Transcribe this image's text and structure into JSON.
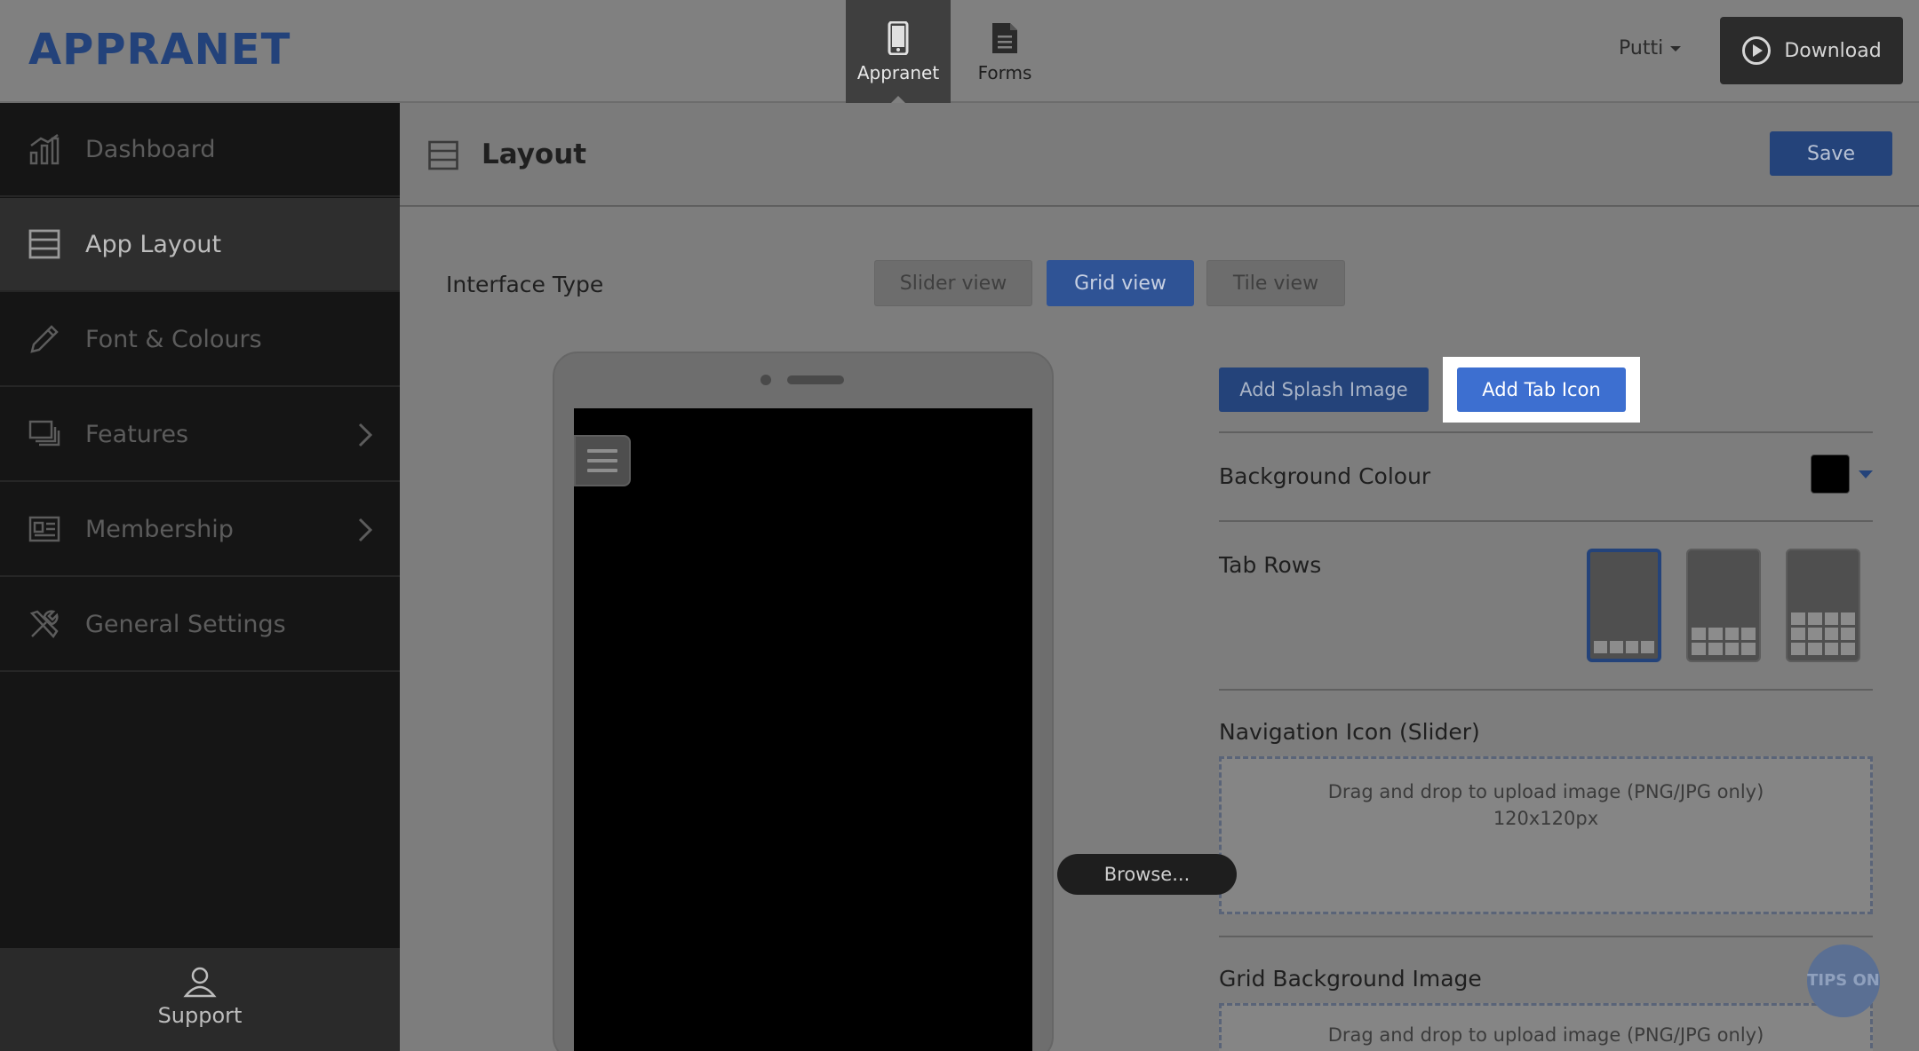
{
  "app": {
    "logo": "APPRANET",
    "nav_tabs": [
      {
        "label": "Appranet",
        "icon": "phone-icon",
        "active": true
      },
      {
        "label": "Forms",
        "icon": "document-icon",
        "active": false
      }
    ],
    "user_name": "Putti",
    "download_label": "Download"
  },
  "sidebar": {
    "items": [
      {
        "label": "Dashboard",
        "icon": "bar-chart-icon",
        "active": false,
        "has_children": false
      },
      {
        "label": "App Layout",
        "icon": "layout-icon",
        "active": true,
        "has_children": false
      },
      {
        "label": "Font & Colours",
        "icon": "pencil-icon",
        "active": false,
        "has_children": false
      },
      {
        "label": "Features",
        "icon": "monitor-stack-icon",
        "active": false,
        "has_children": true
      },
      {
        "label": "Membership",
        "icon": "id-card-icon",
        "active": false,
        "has_children": true
      },
      {
        "label": "General Settings",
        "icon": "tools-icon",
        "active": false,
        "has_children": false
      }
    ],
    "support_label": "Support"
  },
  "page": {
    "title": "Layout",
    "save_label": "Save",
    "interface_type_label": "Interface Type",
    "interface_types": [
      {
        "label": "Slider view",
        "selected": false
      },
      {
        "label": "Grid view",
        "selected": true
      },
      {
        "label": "Tile view",
        "selected": false
      }
    ],
    "add_splash_label": "Add Splash Image",
    "add_tab_icon_label": "Add Tab Icon",
    "background_colour_label": "Background Colour",
    "background_colour_value": "#000000",
    "tab_rows_label": "Tab Rows",
    "tab_rows_options": [
      {
        "rows": 1,
        "selected": true
      },
      {
        "rows": 2,
        "selected": false
      },
      {
        "rows": 3,
        "selected": false
      }
    ],
    "nav_icon_label": "Navigation Icon (Slider)",
    "dropzone_text": "Drag and drop to upload image (PNG/JPG only)",
    "dropzone_size": "120x120px",
    "browse_label": "Browse...",
    "grid_bg_label": "Grid Background Image",
    "grid_dropzone_text": "Drag and drop to upload image (PNG/JPG only)",
    "tips_label": "TIPS ON"
  },
  "colors": {
    "accent": "#24437a",
    "highlight": "#3d6fd0",
    "sidebar_bg": "#151515"
  }
}
